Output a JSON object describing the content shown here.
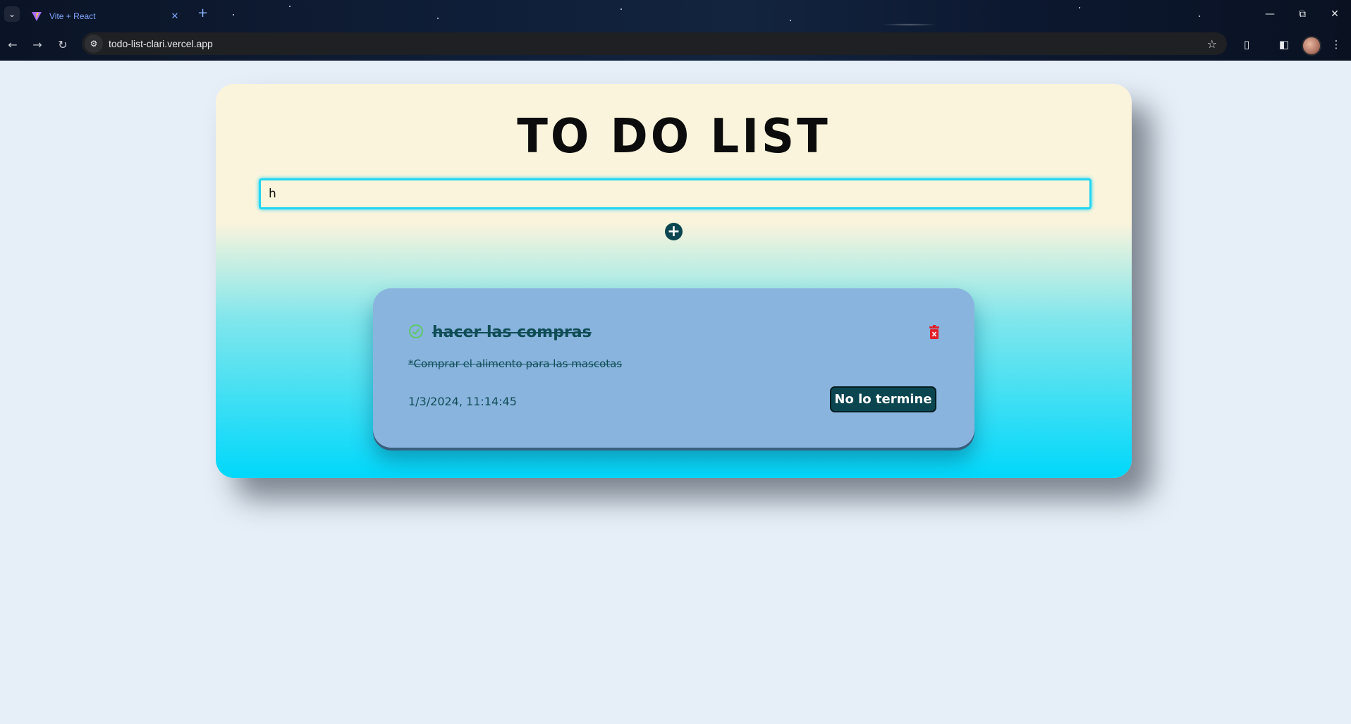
{
  "browser": {
    "tab_title": "Vite + React",
    "url": "todo-list-clari.vercel.app"
  },
  "app": {
    "title": "TO DO LIST",
    "input_value": "h"
  },
  "task": {
    "title": "hacer las compras",
    "description": "*Comprar el alimento para las mascotas",
    "date": "1/3/2024, 11:14:45",
    "toggle_label": "No lo termine",
    "completed": true
  },
  "colors": {
    "accent": "#0b4650",
    "input_border": "#22d6f2",
    "task_card": "#89b4de",
    "delete": "#e0202a",
    "check": "#5fc86b"
  }
}
